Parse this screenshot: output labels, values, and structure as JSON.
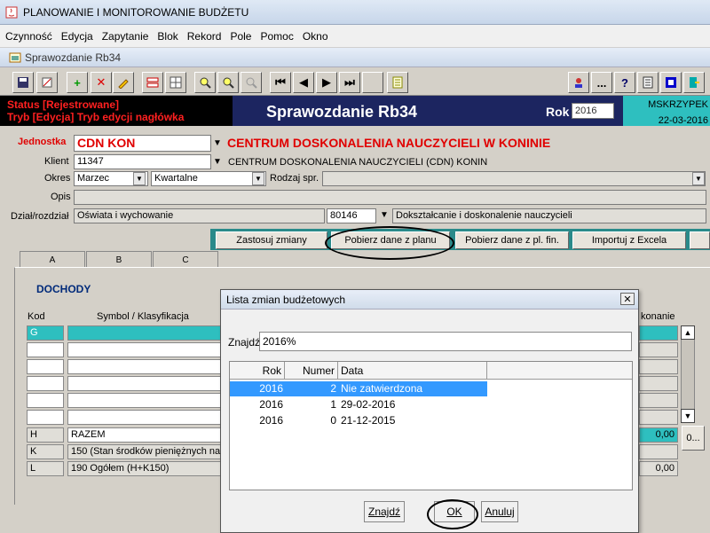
{
  "app": {
    "title": "PLANOWANIE I MONITOROWANIE BUDŻETU"
  },
  "menu": [
    "Czynność",
    "Edycja",
    "Zapytanie",
    "Blok",
    "Rekord",
    "Pole",
    "Pomoc",
    "Okno"
  ],
  "window": {
    "title": "Sprawozdanie Rb34"
  },
  "toolbar": {
    "icons": [
      "save-icon",
      "print-icon",
      "add-icon",
      "delete-icon",
      "edit-icon",
      "block-icon",
      "grid-icon",
      "search-icon",
      "search-next-icon",
      "search-disabled-icon",
      "first-record-icon",
      "prev-record-icon",
      "next-record-icon",
      "last-record-icon",
      "blank-icon",
      "notes-icon"
    ],
    "right_icons": [
      "user-icon",
      "more-icon",
      "help-icon",
      "calculator-icon",
      "window-icon",
      "exit-icon"
    ],
    "more_label": "...",
    "help_label": "?"
  },
  "header": {
    "status": "Status [Rejestrowane]",
    "mode": "Tryb [Edycja] Tryb edycji nagłówka",
    "title": "Sprawozdanie Rb34",
    "rok_label": "Rok",
    "rok_value": "2016",
    "user": "MSKRZYPEK",
    "date": "22-03-2016"
  },
  "form": {
    "jednostka_label": "Jednostka",
    "jednostka_code": "CDN KON",
    "jednostka_name": "CENTRUM DOSKONALENIA NAUCZYCIELI W KONINIE",
    "klient_label": "Klient",
    "klient_code": "11347",
    "klient_name": "CENTRUM DOSKONALENIA NAUCZYCIELI (CDN) KONIN",
    "okres_label": "Okres",
    "okres_value": "Marzec",
    "okres_type": "Kwartalne",
    "rodzaj_label": "Rodzaj spr.",
    "rodzaj_value": "",
    "opis_label": "Opis",
    "opis_value": "",
    "dzial_label": "Dział/rozdział",
    "dzial_value": "Oświata i wychowanie",
    "rozdzial_code": "80146",
    "rozdzial_name": "Dokształcanie i doskonalenie nauczycieli"
  },
  "actions": {
    "apply": "Zastosuj zmiany",
    "fetch_plan": "Pobierz dane z planu",
    "fetch_fin": "Pobierz dane z pl. fin.",
    "import_excel": "Importuj z Excela"
  },
  "tabs": [
    "A",
    "B",
    "C"
  ],
  "main": {
    "section": "DOCHODY",
    "col_kod": "Kod",
    "col_symbol": "Symbol / Klasyfikacja",
    "col_wykonanie": "konanie",
    "first_kod": "G",
    "rows": [
      {
        "kod": "H",
        "symbol": "RAZEM",
        "value": "0,00"
      },
      {
        "kod": "K",
        "symbol": "150 (Stan środków pieniężnych na",
        "value": ""
      },
      {
        "kod": "L",
        "symbol": "190 Ogółem (H+K150)",
        "value": "0,00"
      }
    ],
    "side_button": "0..."
  },
  "dialog": {
    "title": "Lista zmian budżetowych",
    "find_label": "Znajdź",
    "find_value": "2016%",
    "columns": [
      "Rok",
      "Numer",
      "Data"
    ],
    "rows": [
      {
        "rok": "2016",
        "numer": "2",
        "data": "Nie zatwierdzona"
      },
      {
        "rok": "2016",
        "numer": "1",
        "data": "29-02-2016"
      },
      {
        "rok": "2016",
        "numer": "0",
        "data": "21-12-2015"
      }
    ],
    "btn_find": "Znajdź",
    "btn_ok": "OK",
    "btn_cancel": "Anuluj"
  }
}
